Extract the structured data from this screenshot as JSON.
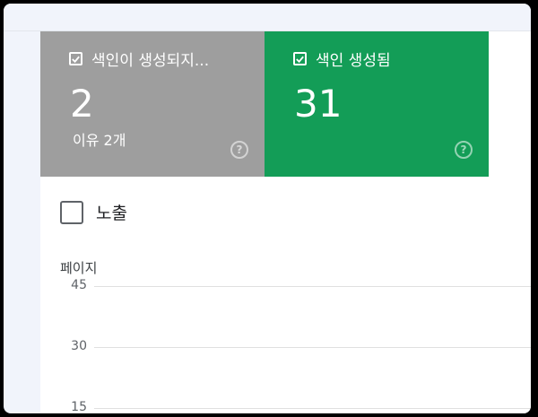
{
  "cards": [
    {
      "title": "색인이 생성되지...",
      "value": "2",
      "sub": "이유 2개",
      "color": "#9e9e9e"
    },
    {
      "title": "색인 생성됨",
      "value": "31",
      "color": "#139d57"
    }
  ],
  "metric": {
    "label": "노출"
  },
  "chart": {
    "ylabel": "페이지",
    "ticks": [
      "45",
      "30",
      "15"
    ]
  }
}
